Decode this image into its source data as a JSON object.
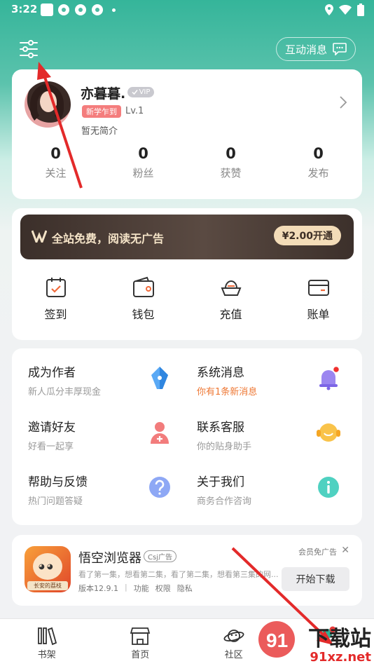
{
  "statusbar": {
    "time": "3:22"
  },
  "header": {
    "message_button_label": "互动消息"
  },
  "profile": {
    "name": "亦暮暮.",
    "vip_badge": "VIP",
    "new_tag": "新学乍到",
    "level": "Lv.1",
    "bio": "暂无简介",
    "stats": [
      {
        "num": "0",
        "label": "关注"
      },
      {
        "num": "0",
        "label": "粉丝"
      },
      {
        "num": "0",
        "label": "获赞"
      },
      {
        "num": "0",
        "label": "发布"
      }
    ]
  },
  "vip": {
    "banner_text": "全站免费，阅读无广告",
    "button_label": "¥2.00开通"
  },
  "quick": [
    {
      "label": "签到"
    },
    {
      "label": "钱包"
    },
    {
      "label": "充值"
    },
    {
      "label": "账单"
    }
  ],
  "menu": [
    {
      "title": "成为作者",
      "subtitle": "新人瓜分丰厚现金"
    },
    {
      "title": "系统消息",
      "subtitle": "你有1条新消息"
    },
    {
      "title": "邀请好友",
      "subtitle": "好看一起享"
    },
    {
      "title": "联系客服",
      "subtitle": "你的贴身助手"
    },
    {
      "title": "帮助与反馈",
      "subtitle": "热门问题答疑"
    },
    {
      "title": "关于我们",
      "subtitle": "商务合作咨询"
    }
  ],
  "ad": {
    "title": "悟空浏览器",
    "tag": "Csj广告",
    "description": "看了第一集，想看第二集，看了第二集，想看第三集的网...",
    "version": "版本12.9.1",
    "links": [
      "功能",
      "权限",
      "隐私"
    ],
    "free_ad": "会员免广告",
    "close": "✕",
    "download_label": "开始下载",
    "icon_caption": "长安的荔枝"
  },
  "tabs": [
    {
      "label": "书架"
    },
    {
      "label": "首页"
    },
    {
      "label": "社区"
    },
    {
      "label": ""
    }
  ],
  "watermark": {
    "text1": "下载站",
    "text2": "91xz.net"
  },
  "colors": {
    "accent": "#35b59a",
    "alert": "#ee7733",
    "vip_gold": "#f3dcb8"
  }
}
